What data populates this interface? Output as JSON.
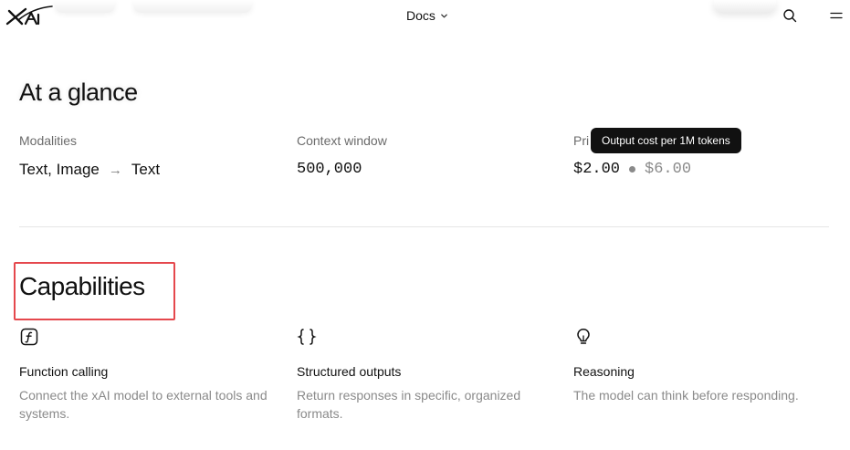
{
  "header": {
    "docs_label": "Docs",
    "icons": {
      "logo": "xai-logo",
      "docs_chevron": "chevron-down-icon",
      "search": "search-icon",
      "menu": "menu-icon"
    }
  },
  "glance": {
    "heading": "At a glance",
    "modalities": {
      "label": "Modalities",
      "input": "Text, Image",
      "arrow": "→",
      "output": "Text"
    },
    "context": {
      "label": "Context window",
      "value": "500,000"
    },
    "pricing": {
      "label": "Pri",
      "input_price": "$2.00",
      "output_price": "$6.00"
    },
    "tooltip": "Output cost per 1M tokens"
  },
  "capabilities": {
    "heading": "Capabilities",
    "items": [
      {
        "icon": "function-icon",
        "title": "Function calling",
        "description": "Connect the xAI model to external tools and systems."
      },
      {
        "icon": "braces-icon",
        "title": "Structured outputs",
        "description": "Return responses in specific, organized formats."
      },
      {
        "icon": "lightbulb-icon",
        "title": "Reasoning",
        "description": "The model can think before responding."
      }
    ]
  },
  "colors": {
    "highlight": "#e5484d",
    "muted": "#8a8a8a",
    "tooltip_bg": "#111111"
  }
}
